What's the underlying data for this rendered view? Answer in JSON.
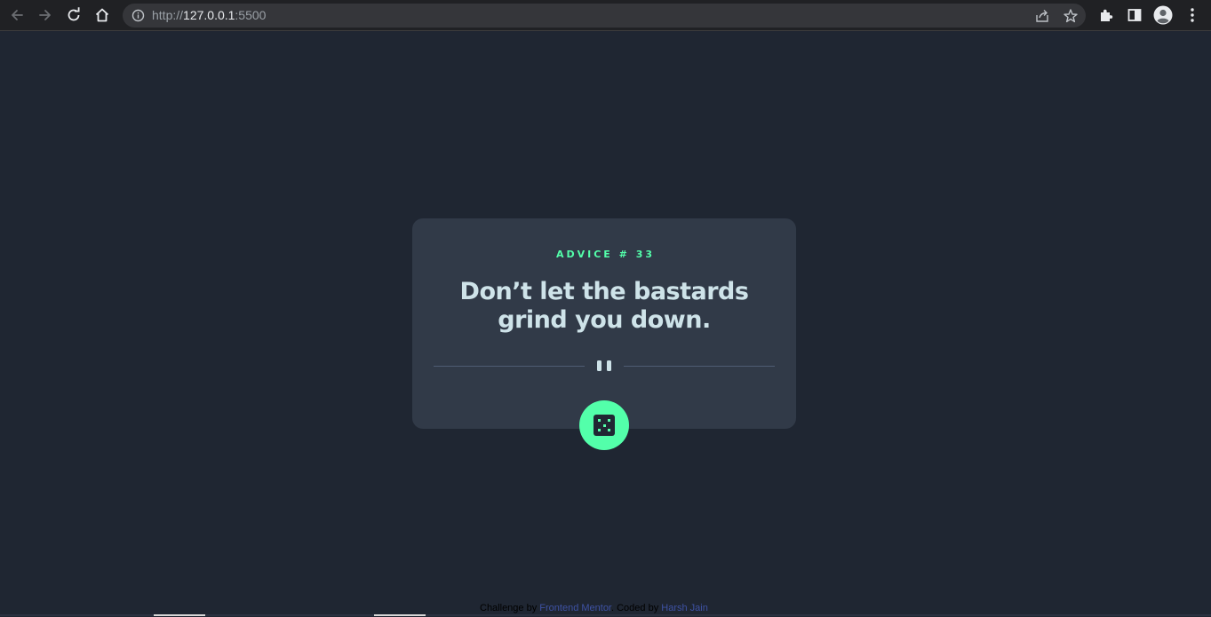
{
  "browser": {
    "url_scheme": "http://",
    "url_host": "127.0.0.1",
    "url_port": ":5500",
    "icons": {
      "back": "arrow-left-icon",
      "forward": "arrow-right-icon",
      "reload": "reload-icon",
      "home": "home-icon",
      "site_info": "info-icon",
      "share": "share-icon",
      "bookmark": "star-icon",
      "extensions": "puzzle-icon",
      "side_panel": "side-panel-icon",
      "profile": "profile-icon",
      "menu": "kebab-menu-icon"
    }
  },
  "advice": {
    "id_label": "ADVICE # 33",
    "text": "Don’t let the bastards grind you down."
  },
  "dice_button": {
    "icon": "dice-icon"
  },
  "attribution": {
    "prefix": "Challenge by ",
    "frontend_mentor": "Frontend Mentor",
    "middle": ". Coded by ",
    "author": "Harsh Jain"
  },
  "colors": {
    "background": "#1f2632",
    "card": "#313a48",
    "accent": "#53ffaa",
    "advice_text": "#cee3e9",
    "divider": "#4f5d74",
    "link": "#3e52a3"
  }
}
